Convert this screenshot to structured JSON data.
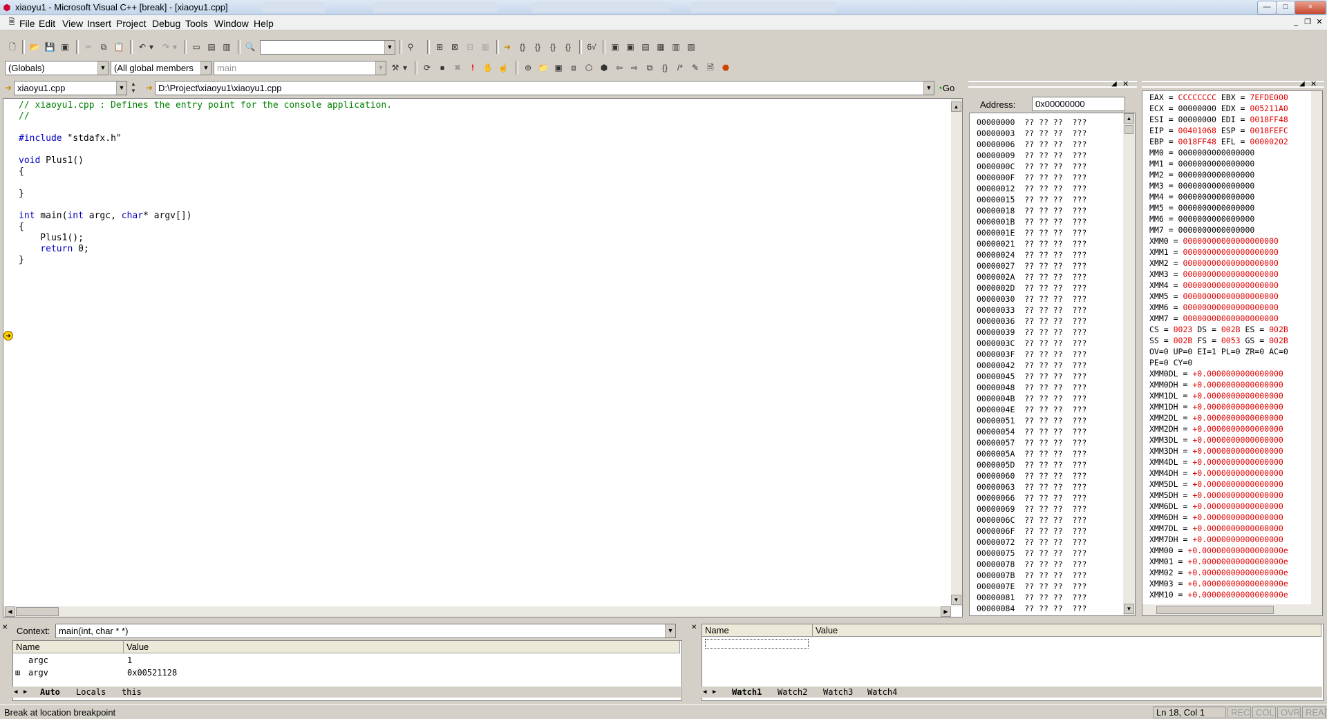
{
  "window": {
    "title": "xiaoyu1 - Microsoft Visual C++ [break] - [xiaoyu1.cpp]",
    "app_icon": "vc-icon",
    "controls": {
      "minimize": "—",
      "maximize": "□",
      "close": "×"
    }
  },
  "menu": [
    "File",
    "Edit",
    "View",
    "Insert",
    "Project",
    "Debug",
    "Tools",
    "Window",
    "Help"
  ],
  "toolbar2": {
    "scope": "(Globals)",
    "members": "(All global members",
    "function": "main"
  },
  "fileselector": {
    "file": "xiaoyu1.cpp",
    "path": "D:\\Project\\xiaoyu1\\xiaoyu1.cpp",
    "go": "Go"
  },
  "code": [
    "// xiaoyu1.cpp : Defines the entry point for the console application.",
    "//",
    "",
    "#include \"stdafx.h\"",
    "",
    "void Plus1()",
    "{",
    "",
    "}",
    "",
    "int main(int argc, char* argv[])",
    "{",
    "    Plus1();",
    "    return 0;",
    "}"
  ],
  "memory": {
    "address_label": "Address:",
    "address_value": "0x00000000",
    "rows": [
      "00000000",
      "00000003",
      "00000006",
      "00000009",
      "0000000C",
      "0000000F",
      "00000012",
      "00000015",
      "00000018",
      "0000001B",
      "0000001E",
      "00000021",
      "00000024",
      "00000027",
      "0000002A",
      "0000002D",
      "00000030",
      "00000033",
      "00000036",
      "00000039",
      "0000003C",
      "0000003F",
      "00000042",
      "00000045",
      "00000048",
      "0000004B",
      "0000004E",
      "00000051",
      "00000054",
      "00000057",
      "0000005A",
      "0000005D",
      "00000060",
      "00000063",
      "00000066",
      "00000069",
      "0000006C",
      "0000006F",
      "00000072",
      "00000075",
      "00000078",
      "0000007B",
      "0000007E",
      "00000081",
      "00000084"
    ],
    "bytes": "?? ?? ??  ???"
  },
  "registers": [
    [
      {
        "t": "EAX = "
      },
      {
        "t": "CCCCCCCC",
        "r": 1
      },
      {
        "t": " EBX = "
      },
      {
        "t": "7EFDE000",
        "r": 1
      }
    ],
    [
      {
        "t": "ECX = "
      },
      {
        "t": "00000000"
      },
      {
        "t": " EDX = "
      },
      {
        "t": "005211A0",
        "r": 1
      }
    ],
    [
      {
        "t": "ESI = "
      },
      {
        "t": "00000000"
      },
      {
        "t": " EDI = "
      },
      {
        "t": "0018FF48",
        "r": 1
      }
    ],
    [
      {
        "t": "EIP = "
      },
      {
        "t": "00401068",
        "r": 1
      },
      {
        "t": " ESP = "
      },
      {
        "t": "0018FEFC",
        "r": 1
      }
    ],
    [
      {
        "t": "EBP = "
      },
      {
        "t": "0018FF48",
        "r": 1
      },
      {
        "t": " EFL = "
      },
      {
        "t": "00000202",
        "r": 1
      }
    ],
    [
      {
        "t": "MM0 = 0000000000000000"
      }
    ],
    [
      {
        "t": "MM1 = 0000000000000000"
      }
    ],
    [
      {
        "t": "MM2 = 0000000000000000"
      }
    ],
    [
      {
        "t": "MM3 = 0000000000000000"
      }
    ],
    [
      {
        "t": "MM4 = 0000000000000000"
      }
    ],
    [
      {
        "t": "MM5 = 0000000000000000"
      }
    ],
    [
      {
        "t": "MM6 = 0000000000000000"
      }
    ],
    [
      {
        "t": "MM7 = 0000000000000000"
      }
    ],
    [
      {
        "t": "XMM0 = "
      },
      {
        "t": "00000000000000000000",
        "r": 1
      }
    ],
    [
      {
        "t": "XMM1 = "
      },
      {
        "t": "00000000000000000000",
        "r": 1
      }
    ],
    [
      {
        "t": "XMM2 = "
      },
      {
        "t": "00000000000000000000",
        "r": 1
      }
    ],
    [
      {
        "t": "XMM3 = "
      },
      {
        "t": "00000000000000000000",
        "r": 1
      }
    ],
    [
      {
        "t": "XMM4 = "
      },
      {
        "t": "00000000000000000000",
        "r": 1
      }
    ],
    [
      {
        "t": "XMM5 = "
      },
      {
        "t": "00000000000000000000",
        "r": 1
      }
    ],
    [
      {
        "t": "XMM6 = "
      },
      {
        "t": "00000000000000000000",
        "r": 1
      }
    ],
    [
      {
        "t": "XMM7 = "
      },
      {
        "t": "00000000000000000000",
        "r": 1
      }
    ],
    [
      {
        "t": "CS = "
      },
      {
        "t": "0023",
        "r": 1
      },
      {
        "t": " DS = "
      },
      {
        "t": "002B",
        "r": 1
      },
      {
        "t": " ES = "
      },
      {
        "t": "002B",
        "r": 1
      }
    ],
    [
      {
        "t": "SS = "
      },
      {
        "t": "002B",
        "r": 1
      },
      {
        "t": " FS = "
      },
      {
        "t": "0053",
        "r": 1
      },
      {
        "t": " GS = "
      },
      {
        "t": "002B",
        "r": 1
      }
    ],
    [
      {
        "t": "OV=0 UP=0 EI=1 PL=0 ZR=0 AC=0"
      }
    ],
    [
      {
        "t": "PE=0 CY=0"
      }
    ],
    [
      {
        "t": "XMM0DL = "
      },
      {
        "t": "+0.0000000000000000",
        "r": 1
      }
    ],
    [
      {
        "t": "XMM0DH = "
      },
      {
        "t": "+0.0000000000000000",
        "r": 1
      }
    ],
    [
      {
        "t": "XMM1DL = "
      },
      {
        "t": "+0.0000000000000000",
        "r": 1
      }
    ],
    [
      {
        "t": "XMM1DH = "
      },
      {
        "t": "+0.0000000000000000",
        "r": 1
      }
    ],
    [
      {
        "t": "XMM2DL = "
      },
      {
        "t": "+0.0000000000000000",
        "r": 1
      }
    ],
    [
      {
        "t": "XMM2DH = "
      },
      {
        "t": "+0.0000000000000000",
        "r": 1
      }
    ],
    [
      {
        "t": "XMM3DL = "
      },
      {
        "t": "+0.0000000000000000",
        "r": 1
      }
    ],
    [
      {
        "t": "XMM3DH = "
      },
      {
        "t": "+0.0000000000000000",
        "r": 1
      }
    ],
    [
      {
        "t": "XMM4DL = "
      },
      {
        "t": "+0.0000000000000000",
        "r": 1
      }
    ],
    [
      {
        "t": "XMM4DH = "
      },
      {
        "t": "+0.0000000000000000",
        "r": 1
      }
    ],
    [
      {
        "t": "XMM5DL = "
      },
      {
        "t": "+0.0000000000000000",
        "r": 1
      }
    ],
    [
      {
        "t": "XMM5DH = "
      },
      {
        "t": "+0.0000000000000000",
        "r": 1
      }
    ],
    [
      {
        "t": "XMM6DL = "
      },
      {
        "t": "+0.0000000000000000",
        "r": 1
      }
    ],
    [
      {
        "t": "XMM6DH = "
      },
      {
        "t": "+0.0000000000000000",
        "r": 1
      }
    ],
    [
      {
        "t": "XMM7DL = "
      },
      {
        "t": "+0.0000000000000000",
        "r": 1
      }
    ],
    [
      {
        "t": "XMM7DH = "
      },
      {
        "t": "+0.0000000000000000",
        "r": 1
      }
    ],
    [
      {
        "t": "XMM00 = "
      },
      {
        "t": "+0.00000000000000000e",
        "r": 1
      }
    ],
    [
      {
        "t": "XMM01 = "
      },
      {
        "t": "+0.00000000000000000e",
        "r": 1
      }
    ],
    [
      {
        "t": "XMM02 = "
      },
      {
        "t": "+0.00000000000000000e",
        "r": 1
      }
    ],
    [
      {
        "t": "XMM03 = "
      },
      {
        "t": "+0.00000000000000000e",
        "r": 1
      }
    ],
    [
      {
        "t": "XMM10 = "
      },
      {
        "t": "+0.00000000000000000e",
        "r": 1
      }
    ]
  ],
  "variables": {
    "context_label": "Context:",
    "context_value": "main(int, char * *)",
    "columns": [
      "Name",
      "Value"
    ],
    "rows": [
      {
        "expand": "",
        "name": "argc",
        "value": "1"
      },
      {
        "expand": "⊞",
        "name": "argv",
        "value": "0x00521128"
      }
    ],
    "tabs": [
      "Auto",
      "Locals",
      "this"
    ]
  },
  "watch": {
    "columns": [
      "Name",
      "Value"
    ],
    "tabs": [
      "Watch1",
      "Watch2",
      "Watch3",
      "Watch4"
    ]
  },
  "status": {
    "message": "Break at location breakpoint",
    "position": "Ln 18, Col 1",
    "indicators": [
      "REC",
      "COL",
      "OVR",
      "READ"
    ]
  },
  "colors": {
    "comment": "#008000",
    "keyword": "#0000c0",
    "changed_register": "#e00000"
  }
}
